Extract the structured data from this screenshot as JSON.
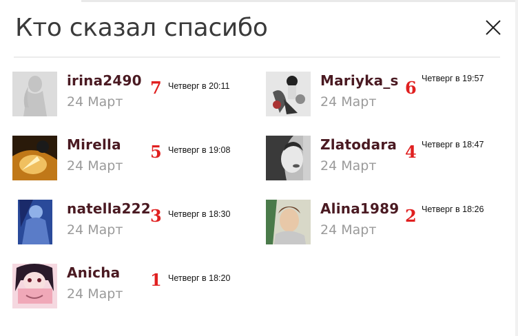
{
  "dialog": {
    "title": "Кто сказал спасибо",
    "close_icon": "close-icon"
  },
  "entries": [
    {
      "username": "irina2490",
      "date": "24 Март",
      "rank": "7",
      "time": "Четверг в 20:11",
      "avatar_icon": "user-silhouette-icon"
    },
    {
      "username": "Mariyka_s",
      "date": "24 Март",
      "rank": "6",
      "time": "Четверг в 19:57",
      "avatar_icon": "avatar-photo"
    },
    {
      "username": "Mirella",
      "date": "24 Март",
      "rank": "5",
      "time": "Четверг в 19:08",
      "avatar_icon": "avatar-photo"
    },
    {
      "username": "Zlatodara",
      "date": "24 Март",
      "rank": "4",
      "time": "Четверг в 18:47",
      "avatar_icon": "avatar-photo"
    },
    {
      "username": "natella222",
      "date": "24 Март",
      "rank": "3",
      "time": "Четверг в 18:30",
      "avatar_icon": "avatar-photo"
    },
    {
      "username": "Alina1989",
      "date": "24 Март",
      "rank": "2",
      "time": "Четверг в 18:26",
      "avatar_icon": "avatar-photo"
    },
    {
      "username": "Anicha",
      "date": "24 Март",
      "rank": "1",
      "time": "Четверг в 18:20",
      "avatar_icon": "avatar-photo"
    }
  ],
  "colors": {
    "username": "#4a1a22",
    "date": "#9a9a9a",
    "rank": "#e02020",
    "title": "#3a3a3a"
  }
}
